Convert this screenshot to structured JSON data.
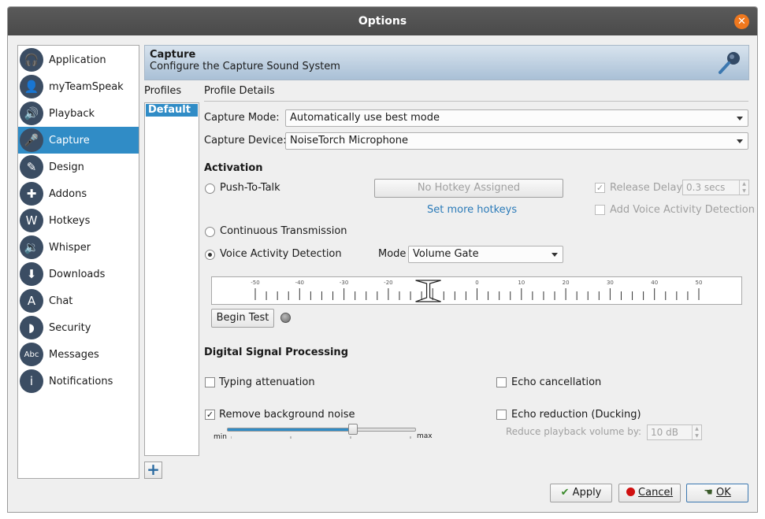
{
  "window": {
    "title": "Options"
  },
  "sidebar": {
    "items": [
      {
        "label": "Application",
        "icon": "headset-icon"
      },
      {
        "label": "myTeamSpeak",
        "icon": "user-icon"
      },
      {
        "label": "Playback",
        "icon": "speaker-icon"
      },
      {
        "label": "Capture",
        "icon": "microphone-icon",
        "active": true
      },
      {
        "label": "Design",
        "icon": "design-icon"
      },
      {
        "label": "Addons",
        "icon": "puzzle-icon"
      },
      {
        "label": "Hotkeys",
        "icon": "hotkey-icon"
      },
      {
        "label": "Whisper",
        "icon": "whisper-icon"
      },
      {
        "label": "Downloads",
        "icon": "download-icon"
      },
      {
        "label": "Chat",
        "icon": "chat-icon"
      },
      {
        "label": "Security",
        "icon": "shield-icon"
      },
      {
        "label": "Messages",
        "icon": "messages-icon"
      },
      {
        "label": "Notifications",
        "icon": "info-icon"
      }
    ]
  },
  "header": {
    "title": "Capture",
    "subtitle": "Configure the Capture Sound System"
  },
  "profiles": {
    "label": "Profiles",
    "items": [
      "Default"
    ]
  },
  "details": {
    "label": "Profile Details",
    "capture_mode_label": "Capture Mode:",
    "capture_mode_value": "Automatically use best mode",
    "capture_device_label": "Capture Device:",
    "capture_device_value": "NoiseTorch Microphone"
  },
  "activation": {
    "heading": "Activation",
    "push_to_talk": "Push-To-Talk",
    "hotkey_button": "No Hotkey Assigned",
    "set_more_hotkeys": "Set more hotkeys",
    "release_delay_label": "Release Delay",
    "release_delay_checked": true,
    "release_delay_value": "0.3 secs",
    "add_vad_label": "Add Voice Activity Detection",
    "continuous": "Continuous Transmission",
    "vad": "Voice Activity Detection",
    "vad_selected": true,
    "mode_label": "Mode",
    "mode_value": "Volume Gate",
    "meter_ticks": [
      "-50",
      "-40",
      "-30",
      "-20",
      "",
      "0",
      "10",
      "20",
      "30",
      "40",
      "50"
    ],
    "meter_marker_value": -11,
    "begin_test": "Begin Test"
  },
  "dsp": {
    "heading": "Digital Signal Processing",
    "typing_attenuation": "Typing attenuation",
    "typing_checked": false,
    "remove_noise": "Remove background noise",
    "remove_noise_checked": true,
    "slider_min": "min",
    "slider_max": "max",
    "slider_level": 0.67,
    "echo_cancellation": "Echo cancellation",
    "echo_cancellation_checked": false,
    "echo_reduction": "Echo reduction (Ducking)",
    "echo_reduction_checked": false,
    "reduce_label": "Reduce playback volume by:",
    "reduce_value": "10 dB"
  },
  "footer": {
    "apply": "Apply",
    "cancel": "Cancel",
    "ok": "OK"
  },
  "colors": {
    "accent": "#308cc6",
    "close": "#f0781e"
  }
}
